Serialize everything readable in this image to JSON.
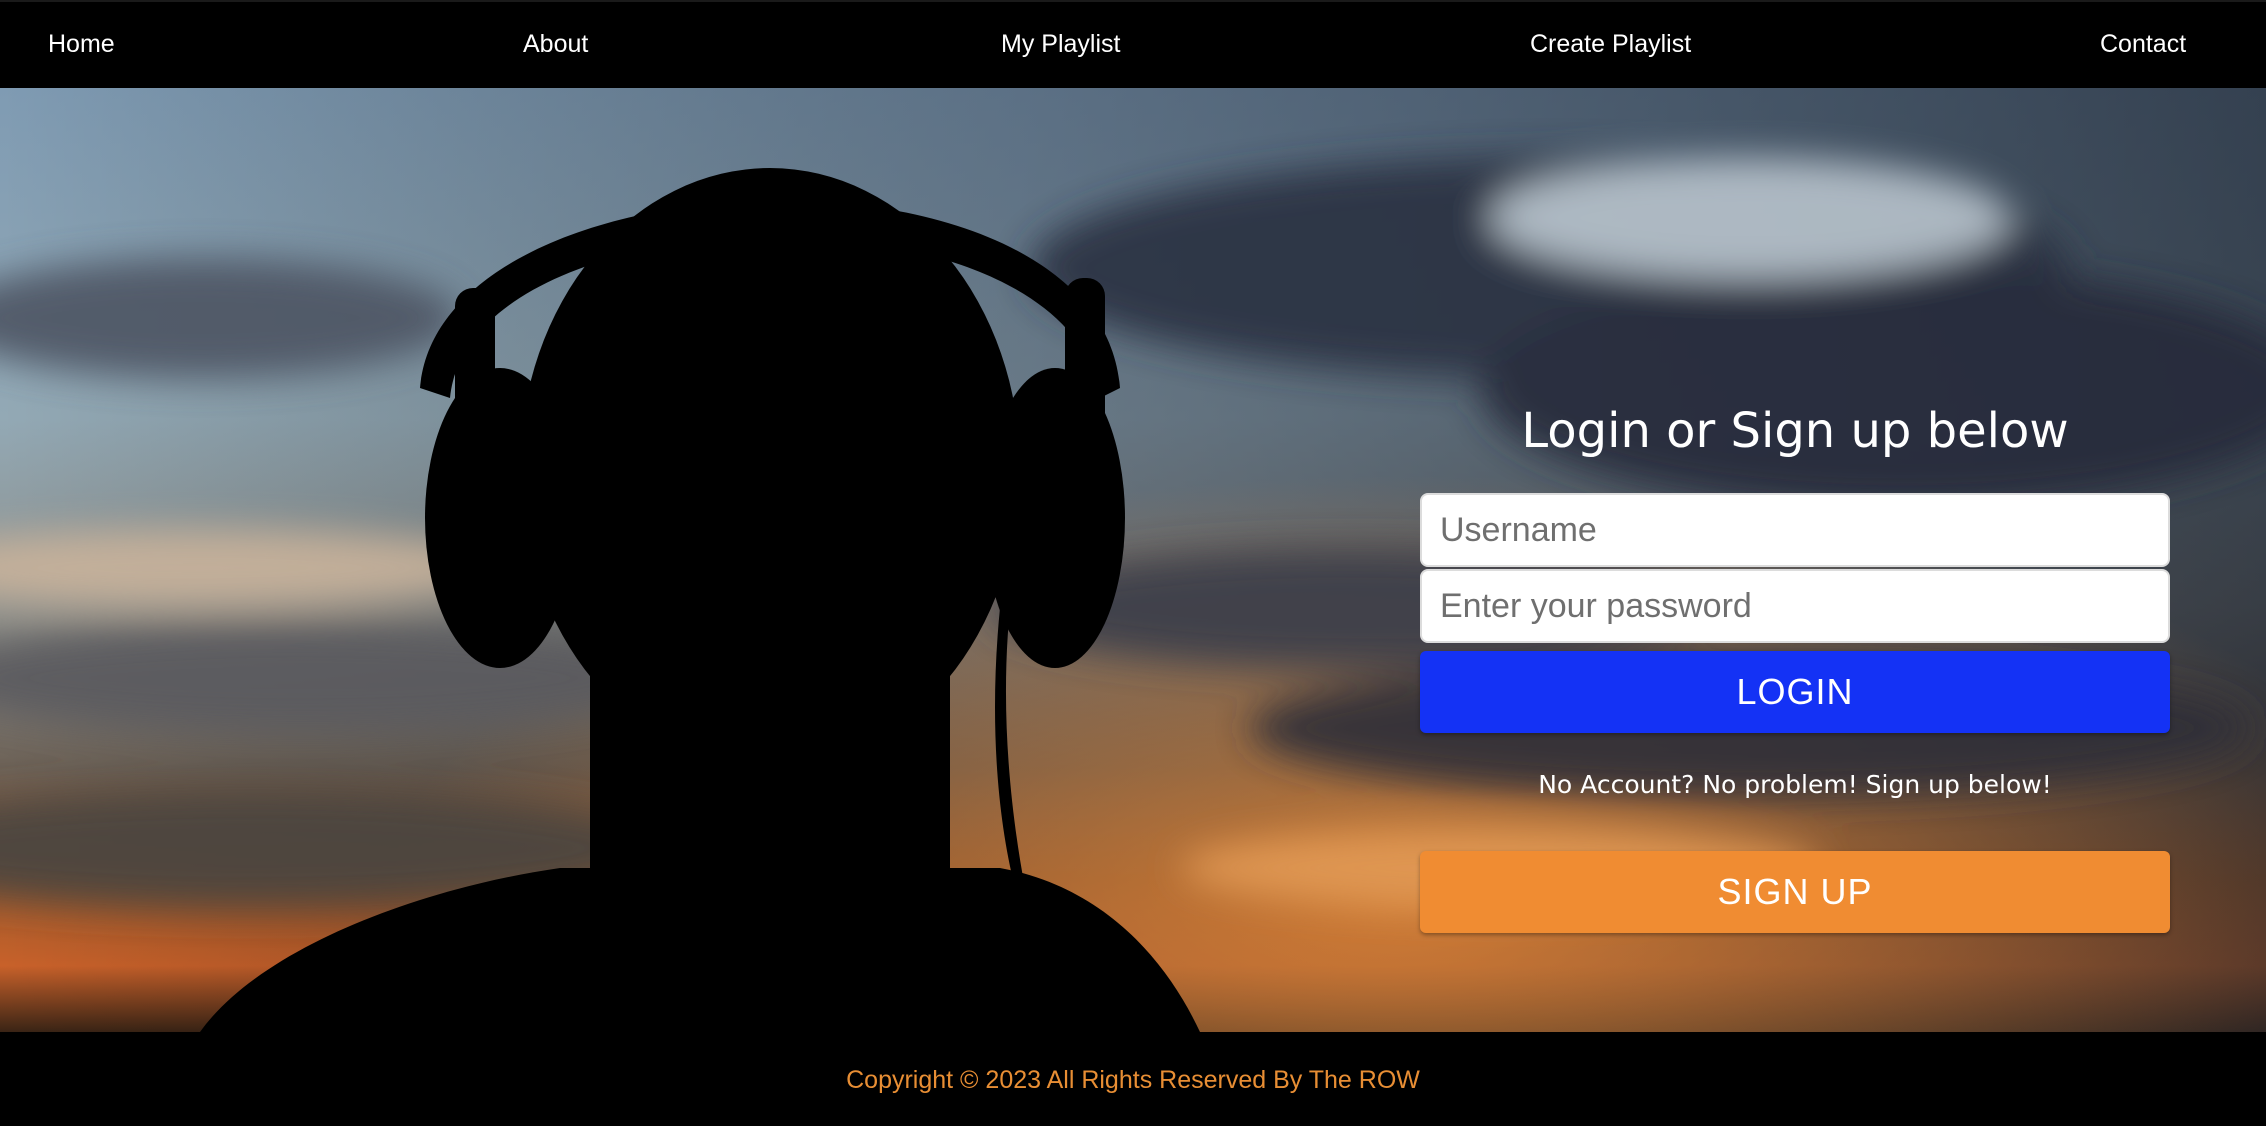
{
  "nav": {
    "items": [
      {
        "label": "Home"
      },
      {
        "label": "About"
      },
      {
        "label": "My Playlist"
      },
      {
        "label": "Create Playlist"
      },
      {
        "label": "Contact"
      }
    ]
  },
  "hero": {
    "image": "silhouette-with-headphones-at-sunset"
  },
  "form": {
    "title": "Login or Sign up below",
    "username_placeholder": "Username",
    "password_placeholder": "Enter your password",
    "login_label": "LOGIN",
    "signup_note": "No Account? No problem! Sign up below!",
    "signup_label": "SIGN UP"
  },
  "footer": {
    "copyright": "Copyright © 2023 All Rights Reserved By The ROW"
  },
  "colors": {
    "login_button": "#1432f5",
    "signup_button": "#f08c32",
    "footer_text": "#e88e34",
    "nav_background": "#000000"
  }
}
